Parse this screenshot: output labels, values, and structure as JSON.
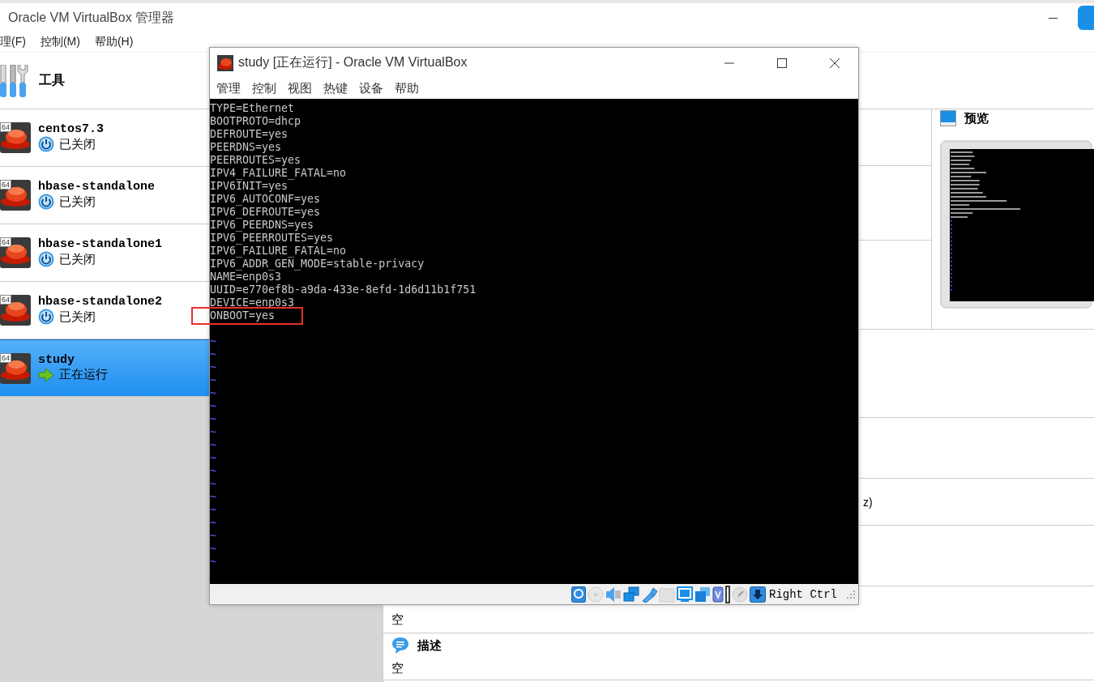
{
  "manager": {
    "title": "Oracle VM VirtualBox 管理器",
    "menu": [
      "理(F)",
      "控制(M)",
      "帮助(H)"
    ],
    "tools_label": "工具",
    "vms": [
      {
        "name": "centos7.3",
        "badge": "64",
        "status": "已关闭",
        "running": false,
        "selected": false
      },
      {
        "name": "hbase-standalone",
        "badge": "64",
        "status": "已关闭",
        "running": false,
        "selected": false
      },
      {
        "name": "hbase-standalone1",
        "badge": "64",
        "status": "已关闭",
        "running": false,
        "selected": false
      },
      {
        "name": "hbase-standalone2",
        "badge": "64",
        "status": "已关闭",
        "running": false,
        "selected": false
      },
      {
        "name": "study",
        "badge": "64",
        "status": "正在运行",
        "running": true,
        "selected": true
      }
    ],
    "details": {
      "preview_title": "预览",
      "cut_text": "z)",
      "hidden_section_value": "空",
      "description": {
        "title": "描述",
        "value": "空"
      }
    }
  },
  "vm_window": {
    "title": "study [正在运行] - Oracle VM VirtualBox",
    "menu": [
      "管理",
      "控制",
      "视图",
      "热键",
      "设备",
      "帮助"
    ],
    "lines": [
      {
        "kind": "text",
        "text": "TYPE=Ethernet",
        "highlighted": false
      },
      {
        "kind": "text",
        "text": "BOOTPROTO=dhcp",
        "highlighted": false
      },
      {
        "kind": "text",
        "text": "DEFROUTE=yes",
        "highlighted": false
      },
      {
        "kind": "text",
        "text": "PEERDNS=yes",
        "highlighted": false
      },
      {
        "kind": "text",
        "text": "PEERROUTES=yes",
        "highlighted": false
      },
      {
        "kind": "text",
        "text": "IPV4_FAILURE_FATAL=no",
        "highlighted": false
      },
      {
        "kind": "text",
        "text": "IPV6INIT=yes",
        "highlighted": false
      },
      {
        "kind": "text",
        "text": "IPV6_AUTOCONF=yes",
        "highlighted": false
      },
      {
        "kind": "text",
        "text": "IPV6_DEFROUTE=yes",
        "highlighted": false
      },
      {
        "kind": "text",
        "text": "IPV6_PEERDNS=yes",
        "highlighted": false
      },
      {
        "kind": "text",
        "text": "IPV6_PEERROUTES=yes",
        "highlighted": false
      },
      {
        "kind": "text",
        "text": "IPV6_FAILURE_FATAL=no",
        "highlighted": false
      },
      {
        "kind": "text",
        "text": "IPV6_ADDR_GEN_MODE=stable-privacy",
        "highlighted": false
      },
      {
        "kind": "text",
        "text": "NAME=enp0s3",
        "highlighted": false
      },
      {
        "kind": "text",
        "text": "UUID=e770ef8b-a9da-433e-8efd-1d6d11b1f751",
        "highlighted": false
      },
      {
        "kind": "text",
        "text": "DEVICE=enp0s3",
        "highlighted": false
      },
      {
        "kind": "text",
        "text": "ONBOOT=yes",
        "highlighted": true
      },
      {
        "kind": "tilde",
        "text": "~"
      },
      {
        "kind": "tilde",
        "text": "~"
      },
      {
        "kind": "tilde",
        "text": "~"
      },
      {
        "kind": "tilde",
        "text": "~"
      },
      {
        "kind": "tilde",
        "text": "~"
      },
      {
        "kind": "tilde",
        "text": "~"
      },
      {
        "kind": "tilde",
        "text": "~"
      },
      {
        "kind": "tilde",
        "text": "~"
      },
      {
        "kind": "tilde",
        "text": "~"
      },
      {
        "kind": "tilde",
        "text": "~"
      },
      {
        "kind": "tilde",
        "text": "~"
      },
      {
        "kind": "tilde",
        "text": "~"
      },
      {
        "kind": "tilde",
        "text": "~"
      },
      {
        "kind": "tilde",
        "text": "~"
      },
      {
        "kind": "tilde",
        "text": "~"
      },
      {
        "kind": "tilde",
        "text": "~"
      },
      {
        "kind": "tilde",
        "text": "~"
      },
      {
        "kind": "tilde",
        "text": "~"
      }
    ],
    "host_key": "Right Ctrl"
  }
}
